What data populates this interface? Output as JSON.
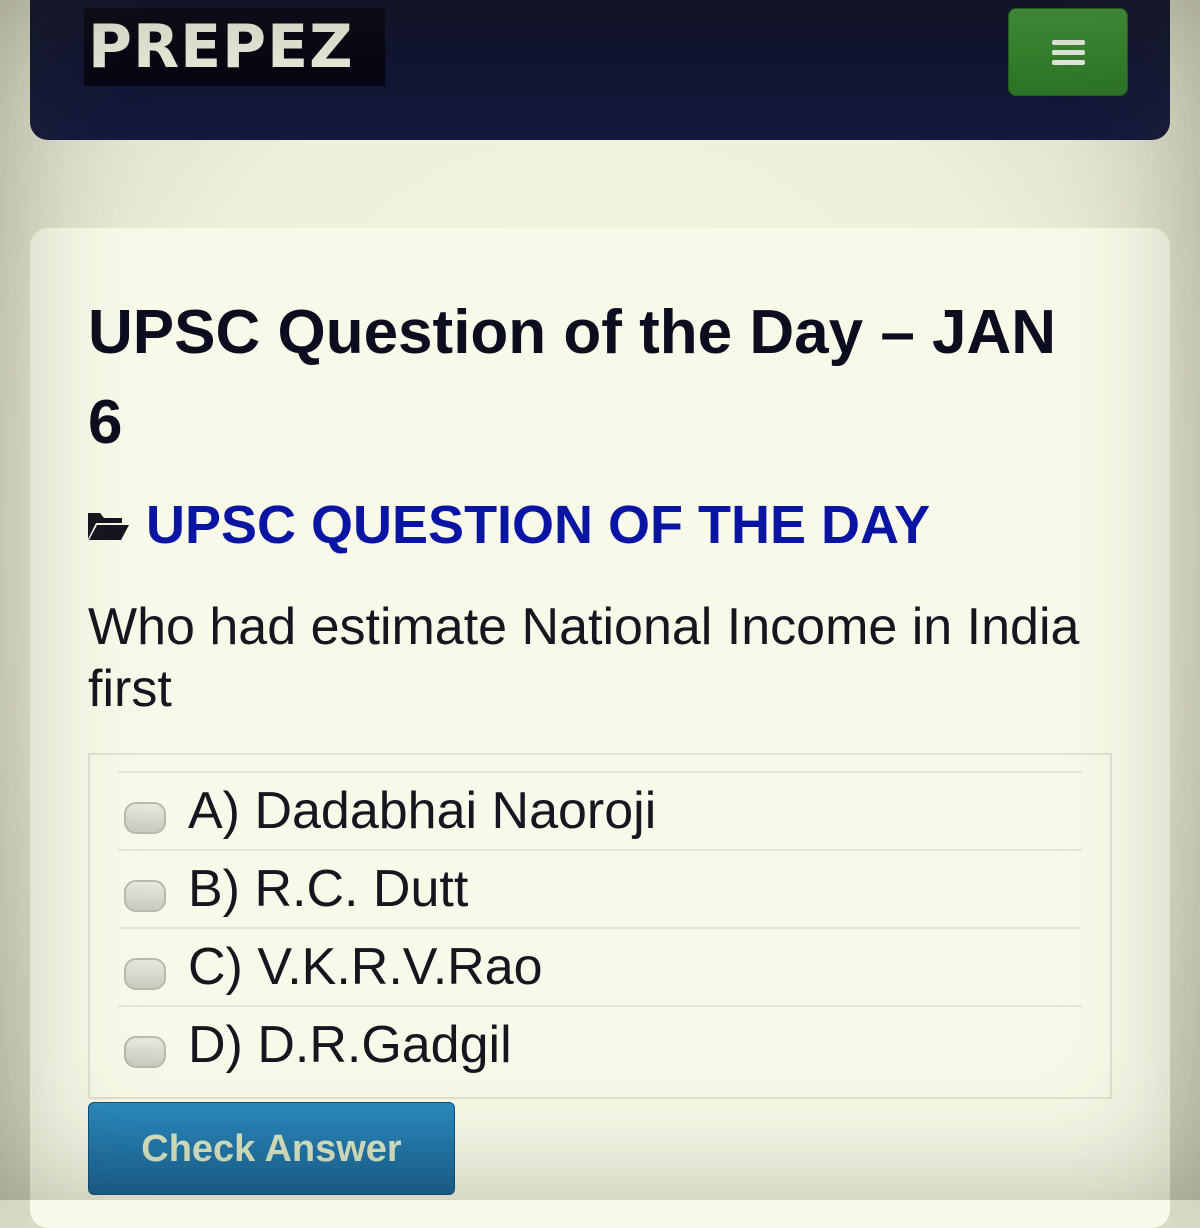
{
  "header": {
    "logo_text": "PREPEZ",
    "menu_icon": "hamburger-icon",
    "menu_color": "#2f7d29",
    "bar_color": "#0b0e28"
  },
  "post": {
    "title": "UPSC Question of the Day – JAN 6",
    "category_icon": "folder-open-icon",
    "category": "UPSC QUESTION OF THE DAY",
    "category_color": "#0b15a3",
    "question": "Who had estimate National Income in India first",
    "options": [
      {
        "label": "A) Dadabhai Naoroji"
      },
      {
        "label": "B) R.C. Dutt"
      },
      {
        "label": "C) V.K.R.V.Rao"
      },
      {
        "label": "D) D.R.Gadgil"
      }
    ],
    "check_label": "Check Answer",
    "check_color": "#1f77aa"
  }
}
